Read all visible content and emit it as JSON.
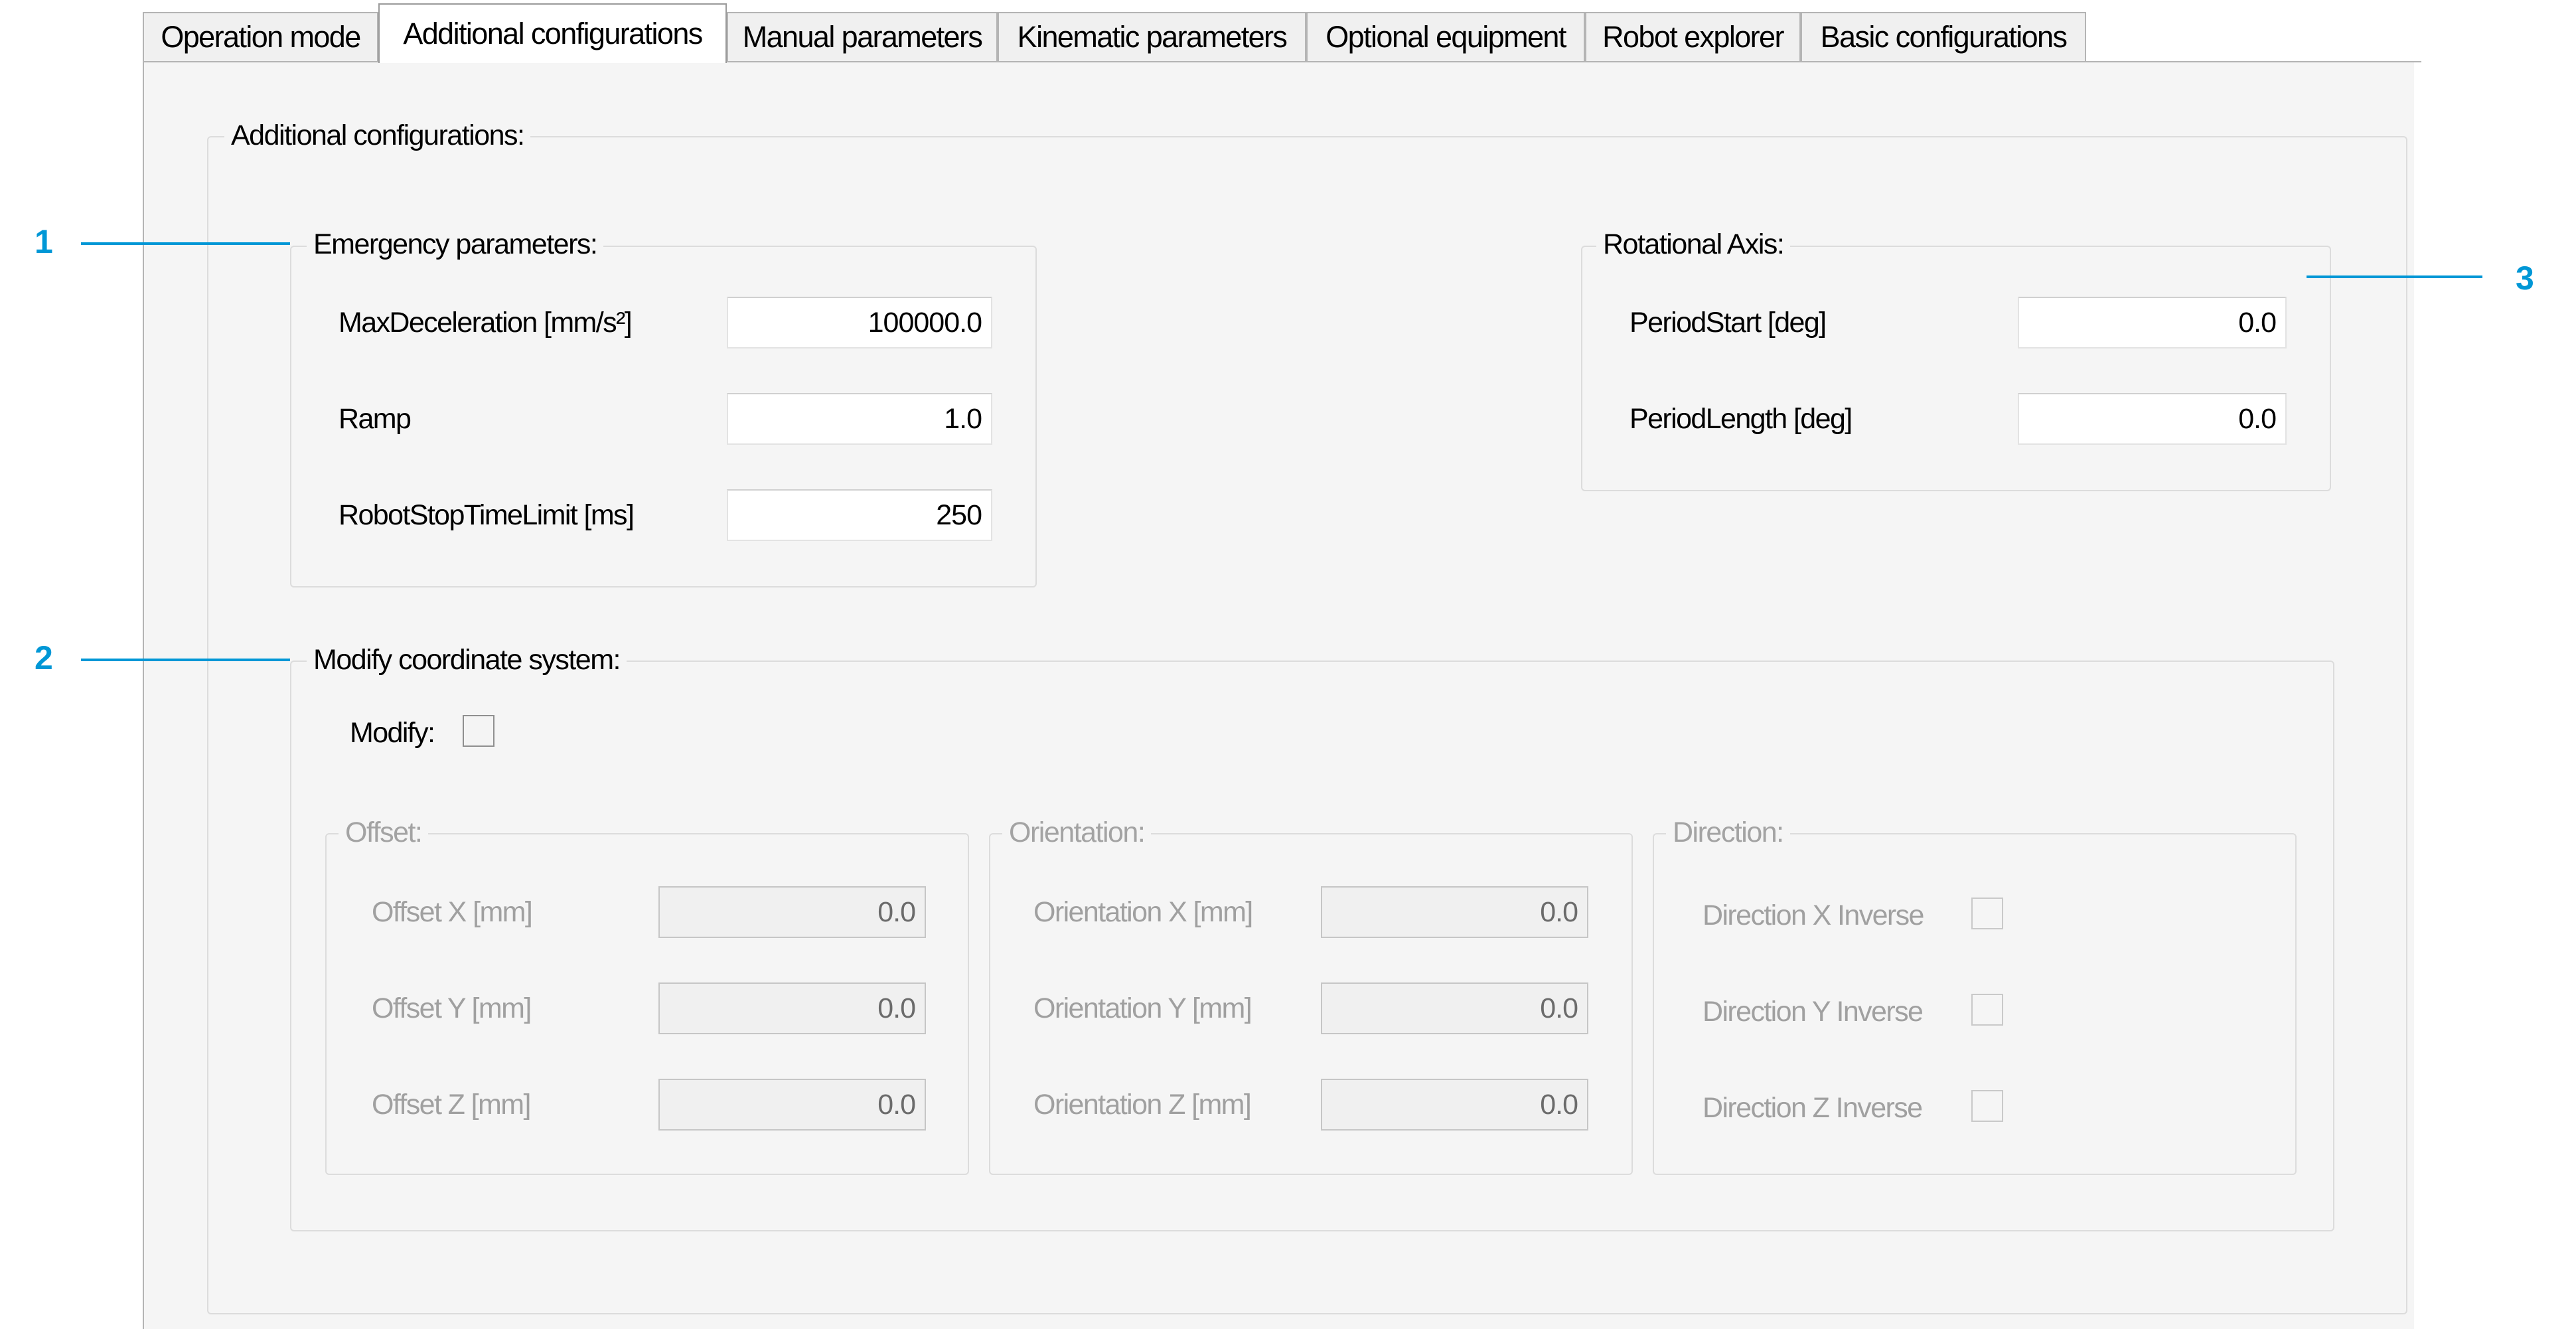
{
  "tabs": [
    {
      "label": "Operation mode"
    },
    {
      "label": "Additional configurations"
    },
    {
      "label": "Manual parameters"
    },
    {
      "label": "Kinematic parameters"
    },
    {
      "label": "Optional equipment"
    },
    {
      "label": "Robot explorer"
    },
    {
      "label": "Basic configurations"
    }
  ],
  "active_tab": "Additional configurations",
  "main_group": {
    "title": "Additional configurations:"
  },
  "emergency": {
    "title": "Emergency parameters:",
    "max_decel": {
      "label": "MaxDeceleration [mm/s²]",
      "value": "100000.0"
    },
    "ramp": {
      "label": "Ramp",
      "value": "1.0"
    },
    "stop_time": {
      "label": "RobotStopTimeLimit [ms]",
      "value": "250"
    }
  },
  "rotational": {
    "title": "Rotational Axis:",
    "period_start": {
      "label": "PeriodStart [deg]",
      "value": "0.0"
    },
    "period_length": {
      "label": "PeriodLength [deg]",
      "value": "0.0"
    }
  },
  "modify": {
    "title": "Modify coordinate system:",
    "checkbox_label": "Modify:",
    "checked": false,
    "offset": {
      "title": "Offset:",
      "x": {
        "label": "Offset X [mm]",
        "value": "0.0"
      },
      "y": {
        "label": "Offset Y [mm]",
        "value": "0.0"
      },
      "z": {
        "label": "Offset Z [mm]",
        "value": "0.0"
      }
    },
    "orientation": {
      "title": "Orientation:",
      "x": {
        "label": "Orientation X [mm]",
        "value": "0.0"
      },
      "y": {
        "label": "Orientation Y [mm]",
        "value": "0.0"
      },
      "z": {
        "label": "Orientation Z [mm]",
        "value": "0.0"
      }
    },
    "direction": {
      "title": "Direction:",
      "x": {
        "label": "Direction X Inverse"
      },
      "y": {
        "label": "Direction Y Inverse"
      },
      "z": {
        "label": "Direction Z Inverse"
      }
    }
  },
  "callouts": [
    "1",
    "2",
    "3"
  ],
  "colors": {
    "callout": "#0097d6",
    "disabled_text": "#a0a0a0"
  }
}
